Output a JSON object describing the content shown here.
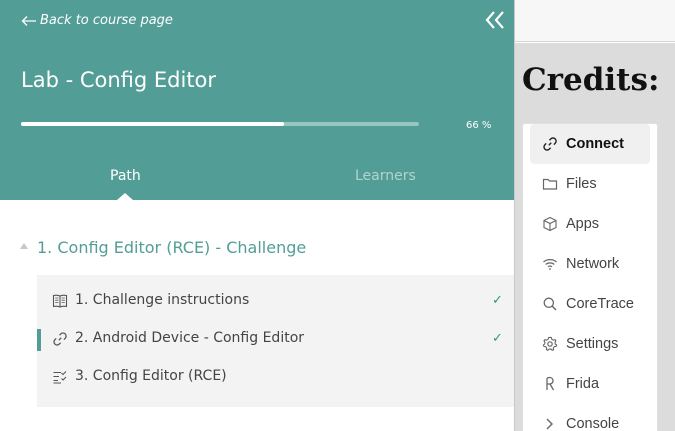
{
  "header": {
    "back_link": "Back to course page",
    "course_title": "Lab - Config Editor",
    "progress_percent": 66,
    "progress_text": "66 %",
    "tabs": [
      "Path",
      "Learners"
    ],
    "active_tab": "Path"
  },
  "section": {
    "title": "1. Config Editor (RCE) - Challenge",
    "steps": [
      {
        "label": "1. Challenge instructions",
        "icon": "book-icon",
        "completed": true,
        "active": false
      },
      {
        "label": "2. Android Device - Config Editor",
        "icon": "link-icon",
        "completed": true,
        "active": true
      },
      {
        "label": "3. Config Editor (RCE)",
        "icon": "checklist-icon",
        "completed": false,
        "active": false
      }
    ],
    "check_mark": "✓"
  },
  "sidebar": {
    "credits_title": "Credits:",
    "menu": [
      {
        "label": "Connect",
        "icon": "link-icon",
        "selected": true
      },
      {
        "label": "Files",
        "icon": "folder-icon",
        "selected": false
      },
      {
        "label": "Apps",
        "icon": "cube-icon",
        "selected": false
      },
      {
        "label": "Network",
        "icon": "wifi-icon",
        "selected": false
      },
      {
        "label": "CoreTrace",
        "icon": "search-icon",
        "selected": false
      },
      {
        "label": "Settings",
        "icon": "gear-icon",
        "selected": false
      },
      {
        "label": "Frida",
        "icon": "frida-icon",
        "selected": false
      },
      {
        "label": "Console",
        "icon": "chevron-right-icon",
        "selected": false
      }
    ]
  },
  "colors": {
    "header_bg": "#529e96",
    "accent": "#529e96",
    "check": "#2e9a6e",
    "credits_bg": "#dcdcdc"
  }
}
